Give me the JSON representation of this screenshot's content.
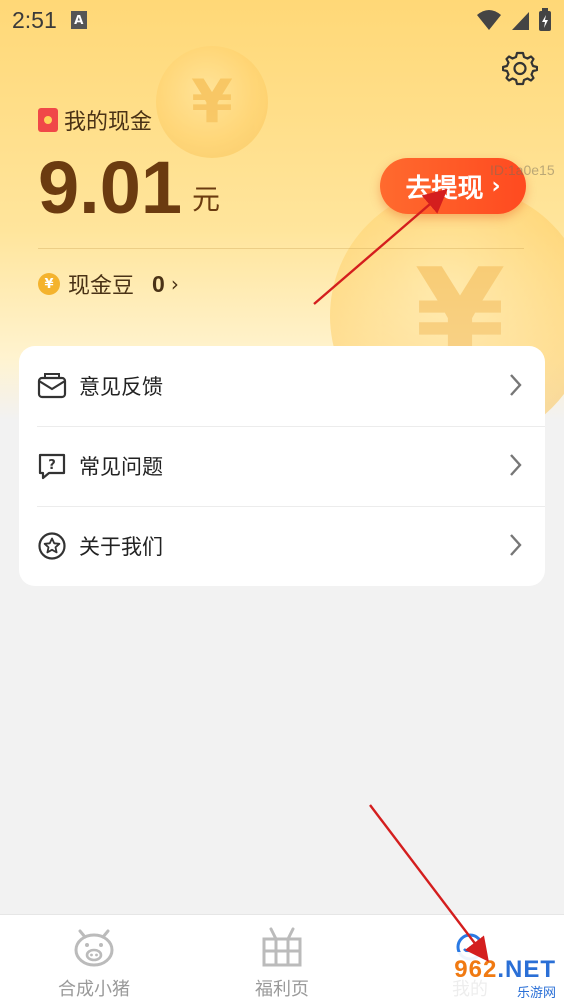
{
  "status_bar": {
    "time": "2:51",
    "notification_letter": "A"
  },
  "header": {
    "cash_label": "我的现金",
    "amount": "9.01",
    "unit": "元",
    "withdraw_label": "去提现",
    "overlay_id": "ID:1a0e15",
    "beans_label": "现金豆",
    "beans_value": "0"
  },
  "menu": {
    "items": [
      {
        "label": "意见反馈",
        "icon": "feedback-envelope-icon"
      },
      {
        "label": "常见问题",
        "icon": "question-bubble-icon"
      },
      {
        "label": "关于我们",
        "icon": "star-circle-icon"
      }
    ]
  },
  "bottom_nav": {
    "tabs": [
      {
        "label": "合成小猪",
        "icon": "pig-icon"
      },
      {
        "label": "福利页",
        "icon": "gift-icon"
      },
      {
        "label": "我的",
        "icon": "profile-icon"
      }
    ]
  },
  "watermark": {
    "site_left": "962",
    "site_right": ".NET",
    "site_sub": "乐游网"
  },
  "colors": {
    "accent": "#ff5a26",
    "amount": "#6b3b10",
    "hero": "#ffd877"
  }
}
